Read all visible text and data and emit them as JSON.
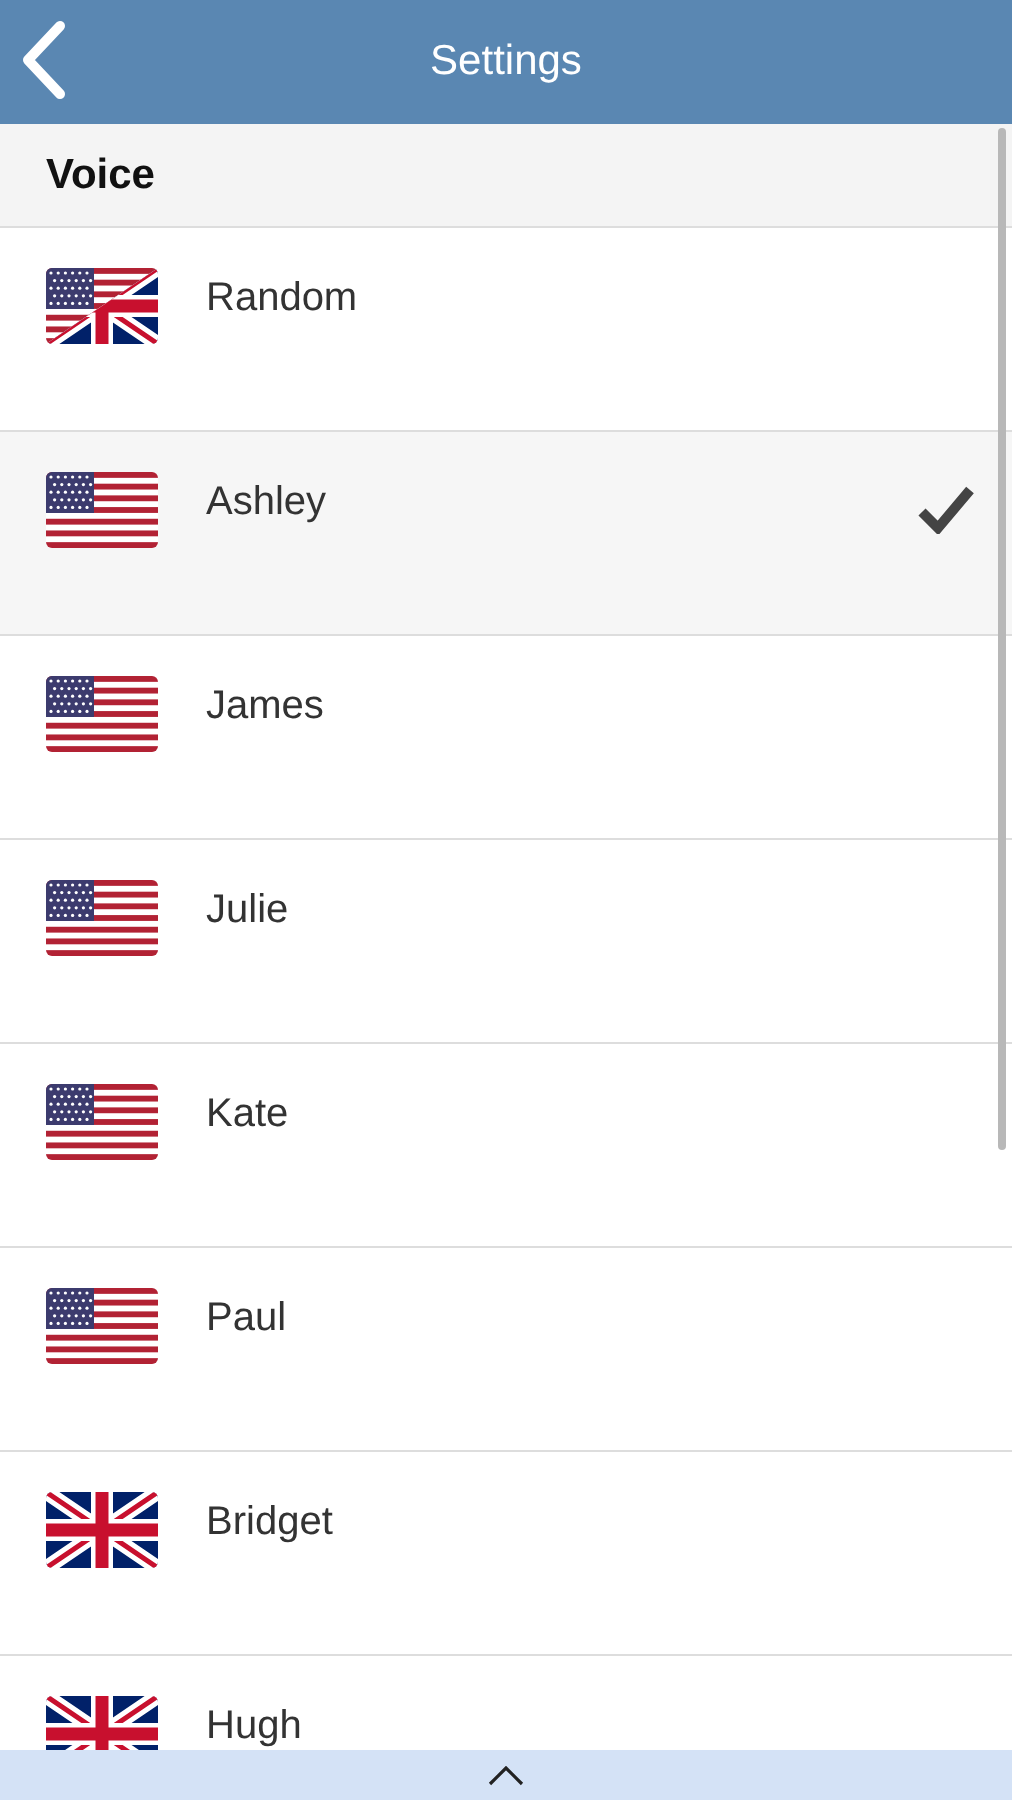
{
  "header": {
    "title": "Settings"
  },
  "section": {
    "title": "Voice"
  },
  "voices": [
    {
      "name": "Random",
      "kind": "mixed",
      "selected": false
    },
    {
      "name": "Ashley",
      "kind": "us",
      "selected": true
    },
    {
      "name": "James",
      "kind": "us",
      "selected": false
    },
    {
      "name": "Julie",
      "kind": "us",
      "selected": false
    },
    {
      "name": "Kate",
      "kind": "us",
      "selected": false
    },
    {
      "name": "Paul",
      "kind": "us",
      "selected": false
    },
    {
      "name": "Bridget",
      "kind": "uk",
      "selected": false
    },
    {
      "name": "Hugh",
      "kind": "uk",
      "selected": false
    }
  ]
}
